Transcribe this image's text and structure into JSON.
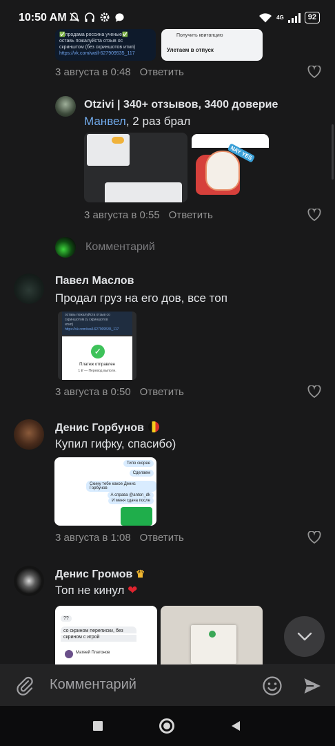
{
  "status": {
    "time": "10:50 AM",
    "network": "4G",
    "battery": "92"
  },
  "comments": [
    {
      "date": "3 августа в 0:48",
      "reply_label": "Ответить",
      "thumb_left_lines": [
        "✅продама россина ученые✅",
        "оставь пожалуйста отзыв ос",
        "скринштом (без скриншотов итип)",
        "https://vk.com/wall-627909535_117"
      ],
      "thumb_right_lines": [
        "Получить квитанцию",
        "Улетаем в отпуск"
      ]
    },
    {
      "author": "Otzivi | 340+ отзывов, 3400 доверие",
      "mention": "Манвел",
      "text": ", 2 раз брал",
      "date": "3 августа в 0:55",
      "reply_label": "Ответить",
      "sticker_text": "NAY YES"
    },
    {
      "composer_placeholder": "Комментарий"
    },
    {
      "author": "Павел Маслов",
      "text": "Продал груз на его дов, все топ",
      "date": "3 августа в 0:50",
      "reply_label": "Ответить",
      "thumb_lines": [
        "оставь пожалуйста отзыв со",
        "скриншотом (у скриншотов",
        "итип)",
        "https://vk.com/wall-627909535_117"
      ],
      "thumb_caption": "Платеж отправлен",
      "thumb_sub": "1 ₽ — Перевод выполн."
    },
    {
      "author": "Денис Горбунов",
      "text": "Купил гифку, спасибо)",
      "date": "3 августа в 1:08",
      "reply_label": "Ответить",
      "chat_bubbles": [
        "Типо скорее",
        "Сделаем",
        "Скину тебе какое Денис Горбунов",
        "А справа @anton_dk",
        "И меня сдача после"
      ]
    },
    {
      "author": "Денис Громов",
      "text": "Топ не кинул",
      "thumb_lines": [
        "??",
        "со скрином переписки, без",
        "скрином с игрой",
        "Матвей Платонов"
      ]
    }
  ],
  "composer": {
    "placeholder": "Комментарий"
  },
  "colors": {
    "background": "#19191a",
    "link": "#71aaeb",
    "muted": "#939393"
  }
}
